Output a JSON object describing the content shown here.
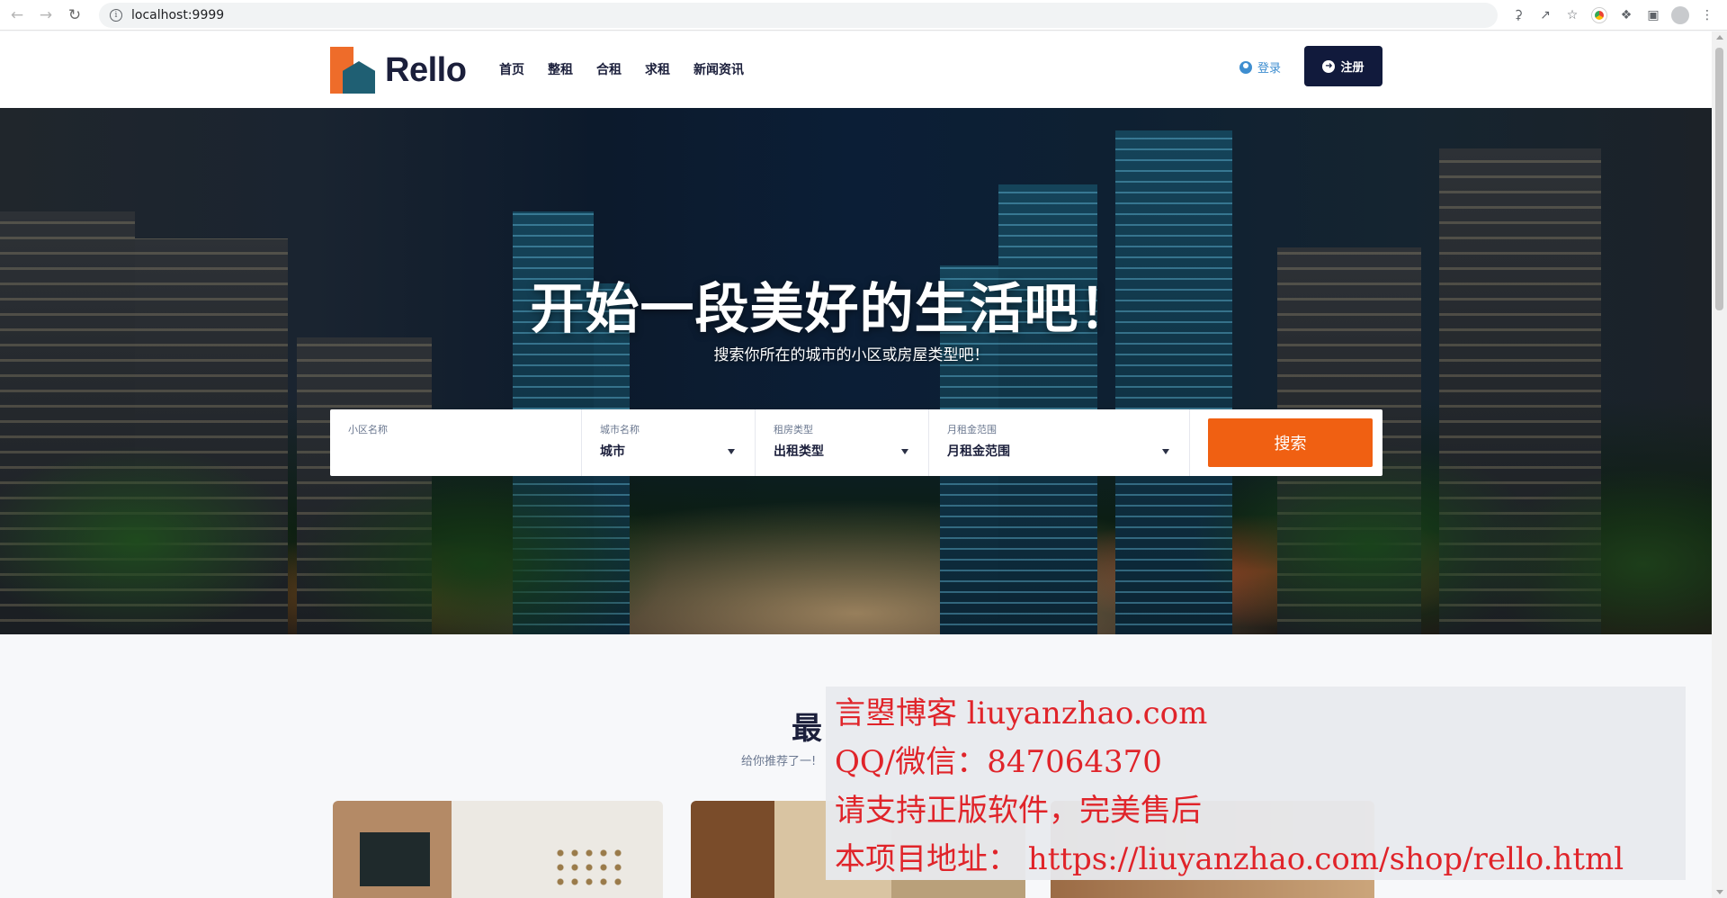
{
  "browser": {
    "url": "localhost:9999",
    "icons": [
      "back-icon",
      "forward-icon",
      "reload-icon",
      "info-icon",
      "key-icon",
      "share-icon",
      "star-icon",
      "chrome-color-icon",
      "extensions-icon",
      "sidepanel-icon",
      "profile-icon",
      "menu-icon"
    ]
  },
  "header": {
    "logo_text": "Rello",
    "nav": [
      "首页",
      "整租",
      "合租",
      "求租",
      "新闻资讯"
    ],
    "login_label": "登录",
    "register_label": "注册",
    "colors": {
      "brand_orange": "#ee6c2a",
      "brand_teal": "#1f5f73",
      "navy": "#111a3c"
    }
  },
  "hero": {
    "title": "开始一段美好的生活吧！",
    "subtitle": "搜索你所在的城市的小区或房屋类型吧！"
  },
  "search": {
    "fields": [
      {
        "label": "小区名称",
        "value": ""
      },
      {
        "label": "城市名称",
        "value": "城市"
      },
      {
        "label": "租房类型",
        "value": "出租类型"
      },
      {
        "label": "月租金范围",
        "value": "月租金范围"
      }
    ],
    "button_label": "搜索",
    "button_color": "#f06012"
  },
  "section": {
    "title": "最",
    "subtitle": "给你推荐了一!"
  },
  "watermark": {
    "lines": [
      "言曌博客 liuyanzhao.com",
      "QQ/微信：847064370",
      "请支持正版软件，完美售后",
      "本项目地址： https://liuyanzhao.com/shop/rello.html"
    ],
    "color": "#e0242a"
  }
}
